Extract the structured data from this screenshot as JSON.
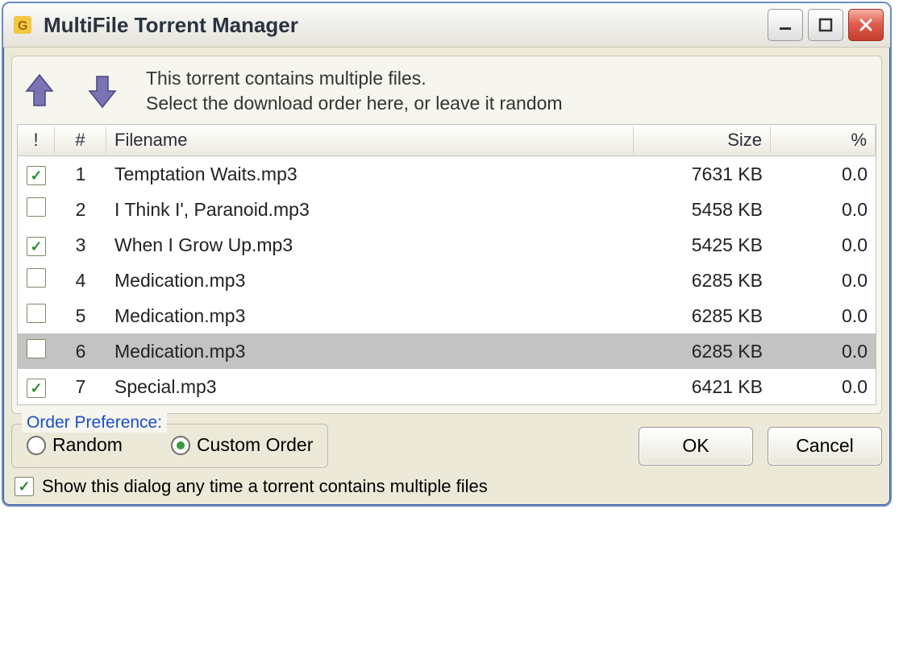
{
  "window": {
    "title": "MultiFile Torrent Manager"
  },
  "instructions": {
    "line1": "This torrent contains multiple files.",
    "line2": "Select the download order here, or leave it random"
  },
  "columns": {
    "check": "!",
    "num": "#",
    "filename": "Filename",
    "size": "Size",
    "percent": "%"
  },
  "files": [
    {
      "checked": true,
      "num": "1",
      "name": "Temptation Waits.mp3",
      "size": "7631 KB",
      "pct": "0.0",
      "selected": false
    },
    {
      "checked": false,
      "num": "2",
      "name": "I Think I', Paranoid.mp3",
      "size": "5458 KB",
      "pct": "0.0",
      "selected": false
    },
    {
      "checked": true,
      "num": "3",
      "name": "When I Grow Up.mp3",
      "size": "5425 KB",
      "pct": "0.0",
      "selected": false
    },
    {
      "checked": false,
      "num": "4",
      "name": "Medication.mp3",
      "size": "6285 KB",
      "pct": "0.0",
      "selected": false
    },
    {
      "checked": false,
      "num": "5",
      "name": "Medication.mp3",
      "size": "6285 KB",
      "pct": "0.0",
      "selected": false
    },
    {
      "checked": false,
      "num": "6",
      "name": "Medication.mp3",
      "size": "6285 KB",
      "pct": "0.0",
      "selected": true
    },
    {
      "checked": true,
      "num": "7",
      "name": "Special.mp3",
      "size": "6421 KB",
      "pct": "0.0",
      "selected": false
    }
  ],
  "order_pref": {
    "legend": "Order Preference:",
    "random": "Random",
    "custom": "Custom Order",
    "selected": "custom"
  },
  "buttons": {
    "ok": "OK",
    "cancel": "Cancel"
  },
  "show_again": {
    "checked": true,
    "label": "Show this dialog any time a torrent contains multiple files"
  }
}
